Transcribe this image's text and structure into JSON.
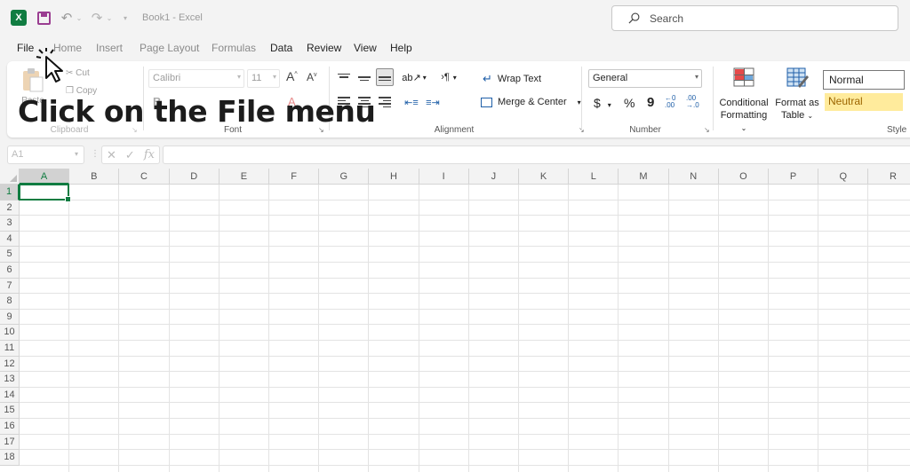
{
  "titlebar": {
    "doc_title": "Book1 - Excel",
    "app_icon_letter": "X"
  },
  "search": {
    "placeholder": "Search"
  },
  "tabs": [
    {
      "label": "File"
    },
    {
      "label": "Home"
    },
    {
      "label": "Insert"
    },
    {
      "label": "Page Layout"
    },
    {
      "label": "Formulas"
    },
    {
      "label": "Data"
    },
    {
      "label": "Review"
    },
    {
      "label": "View"
    },
    {
      "label": "Help"
    }
  ],
  "ribbon": {
    "clipboard": {
      "paste_label": "Paste",
      "cut_label": "Cut",
      "copy_label": "Copy",
      "group_label": "Clipboard"
    },
    "font": {
      "font_name": "Calibri",
      "font_size": "11",
      "grow_label": "A",
      "shrink_label": "A",
      "group_label": "Font"
    },
    "alignment": {
      "wrap_text": "Wrap Text",
      "merge_center": "Merge & Center",
      "group_label": "Alignment"
    },
    "number": {
      "format": "General",
      "currency": "$",
      "percent": "%",
      "comma": "9",
      "group_label": "Number"
    },
    "styles": {
      "conditional_line1": "Conditional",
      "conditional_line2": "Formatting",
      "format_table_line1": "Format as",
      "format_table_line2": "Table",
      "style_normal": "Normal",
      "style_neutral": "Neutral",
      "group_label": "Style"
    }
  },
  "formula_bar": {
    "name_box": "A1",
    "fx_label": "fx"
  },
  "grid": {
    "columns": [
      "A",
      "B",
      "C",
      "D",
      "E",
      "F",
      "G",
      "H",
      "I",
      "J",
      "K",
      "L",
      "M",
      "N",
      "O",
      "P",
      "Q",
      "R"
    ],
    "rows": [
      "1",
      "2",
      "3",
      "4",
      "5",
      "6",
      "7",
      "8",
      "9",
      "10",
      "11",
      "12",
      "13",
      "14",
      "15",
      "16",
      "17",
      "18"
    ]
  },
  "overlay": {
    "instruction": "Click on the File menu"
  },
  "colors": {
    "excel_green": "#107c41",
    "neutral_fill": "#ffeb9c",
    "neutral_text": "#9c6500"
  }
}
